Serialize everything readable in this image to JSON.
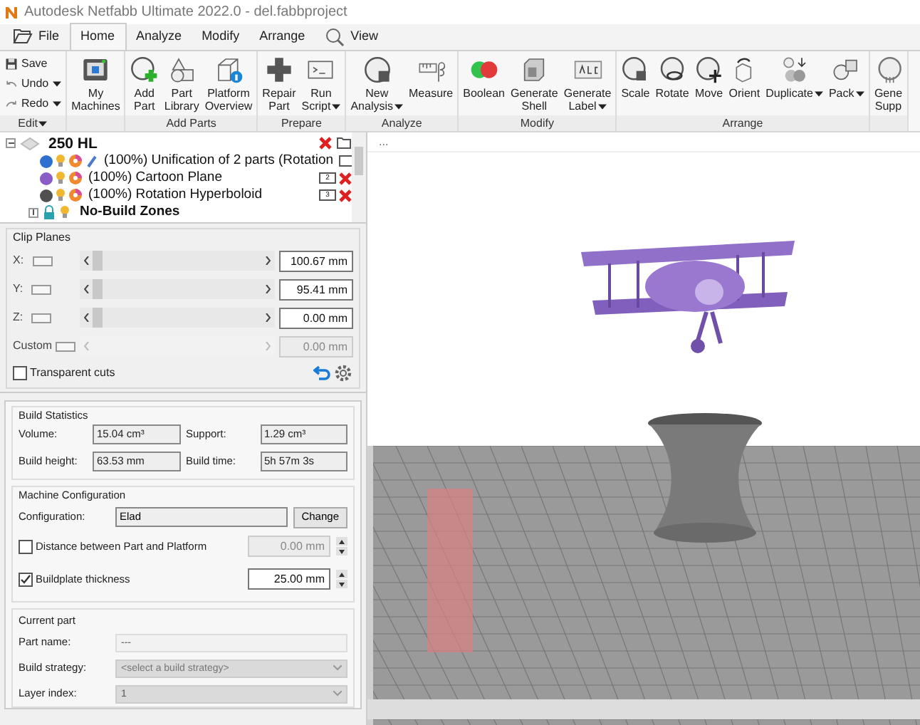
{
  "window": {
    "title": "Autodesk Netfabb Ultimate 2022.0 - del.fabbproject"
  },
  "menu_tabs": [
    {
      "label": "File",
      "kind": "file",
      "selected": false
    },
    {
      "label": "Home",
      "kind": "tab",
      "selected": true
    },
    {
      "label": "Analyze",
      "kind": "tab",
      "selected": false
    },
    {
      "label": "Modify",
      "kind": "tab",
      "selected": false
    },
    {
      "label": "Arrange",
      "kind": "tab",
      "selected": false
    },
    {
      "label": "View",
      "kind": "view",
      "selected": false
    }
  ],
  "ribbon_groups": [
    {
      "label": "Edit",
      "dropdown": true,
      "kind": "small",
      "buttons": [
        {
          "kind": "save",
          "lines": [
            "Save"
          ],
          "dropdown": false
        },
        {
          "kind": "undo",
          "lines": [
            "Undo"
          ],
          "dropdown": true
        },
        {
          "kind": "redo",
          "lines": [
            "Redo"
          ],
          "dropdown": true
        }
      ]
    },
    {
      "kind": "large",
      "buttons": [
        {
          "kind": "machine",
          "lines": [
            "My",
            "Machines"
          ],
          "dropdown": false
        }
      ]
    },
    {
      "label": "Add Parts",
      "kind": "large",
      "buttons": [
        {
          "kind": "add",
          "lines": [
            "Add",
            "Part"
          ],
          "dropdown": false
        },
        {
          "kind": "library",
          "lines": [
            "Part",
            "Library"
          ],
          "dropdown": false
        },
        {
          "kind": "overview",
          "lines": [
            "Platform",
            "Overview"
          ],
          "dropdown": false
        }
      ]
    },
    {
      "label": "Prepare",
      "kind": "large",
      "buttons": [
        {
          "kind": "repair",
          "lines": [
            "Repair",
            "Part"
          ],
          "dropdown": false
        },
        {
          "kind": "script",
          "lines": [
            "Run",
            "Script"
          ],
          "dropdown": true
        }
      ]
    },
    {
      "label": "Analyze",
      "kind": "large",
      "buttons": [
        {
          "kind": "analysis",
          "lines": [
            "New",
            "Analysis"
          ],
          "dropdown": true
        },
        {
          "kind": "measure",
          "lines": [
            "Measure"
          ],
          "dropdown": false
        }
      ]
    },
    {
      "label": "Modify",
      "kind": "large",
      "buttons": [
        {
          "kind": "boolean",
          "lines": [
            "Boolean"
          ],
          "dropdown": false
        },
        {
          "kind": "shell",
          "lines": [
            "Generate",
            "Shell"
          ],
          "dropdown": false
        },
        {
          "kind": "label",
          "lines": [
            "Generate",
            "Label"
          ],
          "dropdown": true
        }
      ]
    },
    {
      "label": "Arrange",
      "kind": "large",
      "buttons": [
        {
          "kind": "scale",
          "lines": [
            "Scale"
          ],
          "dropdown": false
        },
        {
          "kind": "rotate",
          "lines": [
            "Rotate"
          ],
          "dropdown": false
        },
        {
          "kind": "move",
          "lines": [
            "Move"
          ],
          "dropdown": false
        },
        {
          "kind": "orient",
          "lines": [
            "Orient"
          ],
          "dropdown": false
        },
        {
          "kind": "duplicate",
          "lines": [
            "Duplicate"
          ],
          "dropdown": true
        },
        {
          "kind": "pack",
          "lines": [
            "Pack"
          ],
          "dropdown": true
        }
      ]
    },
    {
      "kind": "large",
      "buttons": [
        {
          "kind": "support",
          "lines": [
            "Gene",
            "Supp"
          ],
          "dropdown": false
        }
      ]
    }
  ],
  "tree": {
    "label": "250 HL",
    "expanded": true,
    "children": [
      {
        "label": "(100%) Unification of 2 parts (Rotation",
        "kind": "part",
        "color": "#2f6fd0",
        "extra": true
      },
      {
        "label": "(100%) Cartoon Plane",
        "kind": "part",
        "color": "#8a5cc8",
        "index": "2",
        "extra": false
      },
      {
        "label": "(100%) Rotation Hyperboloid",
        "kind": "part",
        "color": "#505050",
        "index": "3",
        "extra": false
      },
      {
        "label": "No-Build Zones",
        "kind": "zone",
        "expanded": false
      }
    ]
  },
  "clip_planes": {
    "title": "Clip Planes",
    "rows": [
      {
        "axis": "X:",
        "value": "100.67 mm",
        "disabled": false
      },
      {
        "axis": "Y:",
        "value": "95.41 mm",
        "disabled": false
      },
      {
        "axis": "Z:",
        "value": "0.00 mm",
        "disabled": false
      },
      {
        "axis": "Custom",
        "value": "0.00 mm",
        "disabled": true
      }
    ],
    "transparent_cuts": {
      "label": "Transparent cuts",
      "checked": false
    }
  },
  "build_statistics": {
    "title": "Build Statistics",
    "fields": [
      {
        "label": "Volume:",
        "value": "15.04 cm³"
      },
      {
        "label": "Support:",
        "value": "1.29 cm³"
      },
      {
        "label": "Build height:",
        "value": "63.53 mm"
      },
      {
        "label": "Build time:",
        "value": "5h 57m 3s"
      }
    ]
  },
  "machine_configuration": {
    "title": "Machine Configuration",
    "configuration_label": "Configuration:",
    "configuration": "Elad",
    "change_button": "Change",
    "options": [
      {
        "label": "Distance between Part and Platform",
        "checked": false,
        "value": "0.00 mm"
      },
      {
        "label": "Buildplate thickness",
        "checked": true,
        "value": "25.00 mm"
      }
    ]
  },
  "current_part": {
    "title": "Current part",
    "fields": [
      {
        "label": "Part name:",
        "value": "---",
        "kind": "text"
      },
      {
        "label": "Build strategy:",
        "placeholder": "<select a build strategy>",
        "kind": "select"
      },
      {
        "label": "Layer index:",
        "value": "1",
        "kind": "select"
      }
    ]
  },
  "viewport": {
    "tab_label": "..."
  }
}
